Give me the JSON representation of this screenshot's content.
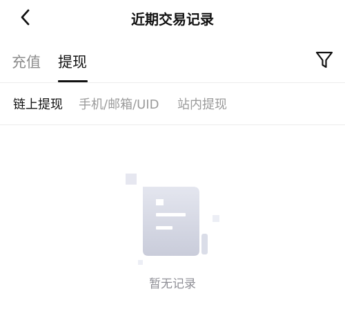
{
  "header": {
    "title": "近期交易记录",
    "back_icon": "chevron-left-icon"
  },
  "tabs": [
    {
      "label": "充值",
      "active": false
    },
    {
      "label": "提现",
      "active": true
    }
  ],
  "filter_icon": "filter-funnel-icon",
  "subtabs": [
    {
      "label": "链上提现",
      "active": true
    },
    {
      "label": "手机/邮箱/UID",
      "active": false
    },
    {
      "label": "站内提现",
      "active": false
    }
  ],
  "empty_state": {
    "icon": "empty-document-icon",
    "message": "暂无记录"
  },
  "colors": {
    "active_text": "#111111",
    "inactive_tab": "#8c8c8c",
    "inactive_subtab": "#9a9a9a",
    "empty_text": "#8e8e95",
    "illustration": "#d9dce8"
  }
}
